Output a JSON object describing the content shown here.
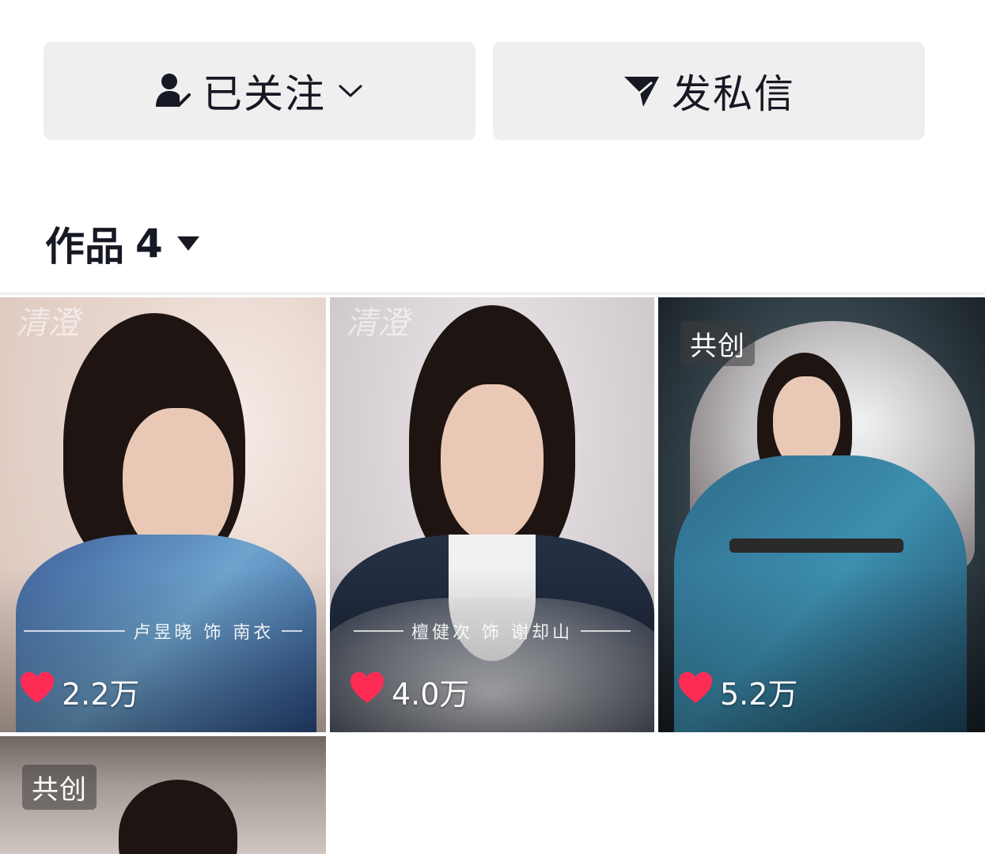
{
  "actions": {
    "follow_label": "已关注",
    "message_label": "发私信"
  },
  "works": {
    "title": "作品",
    "count": "4"
  },
  "tiles": [
    {
      "likes": "2.2万",
      "caption": "卢昱晓 饰 南衣",
      "watermark": "清澄"
    },
    {
      "likes": "4.0万",
      "caption": "檀健次 饰 谢却山",
      "watermark": "清澄"
    },
    {
      "likes": "5.2万",
      "badge": "共创"
    },
    {
      "badge": "共创"
    }
  ],
  "colors": {
    "button_bg": "#efefef",
    "text": "#161823",
    "like_heart": "#fe2c55"
  },
  "icons": {
    "follow": "user-check-icon",
    "follow_dropdown": "chevron-down-icon",
    "message": "paper-plane-icon",
    "works_dropdown": "caret-down-icon",
    "like": "heart-icon"
  }
}
